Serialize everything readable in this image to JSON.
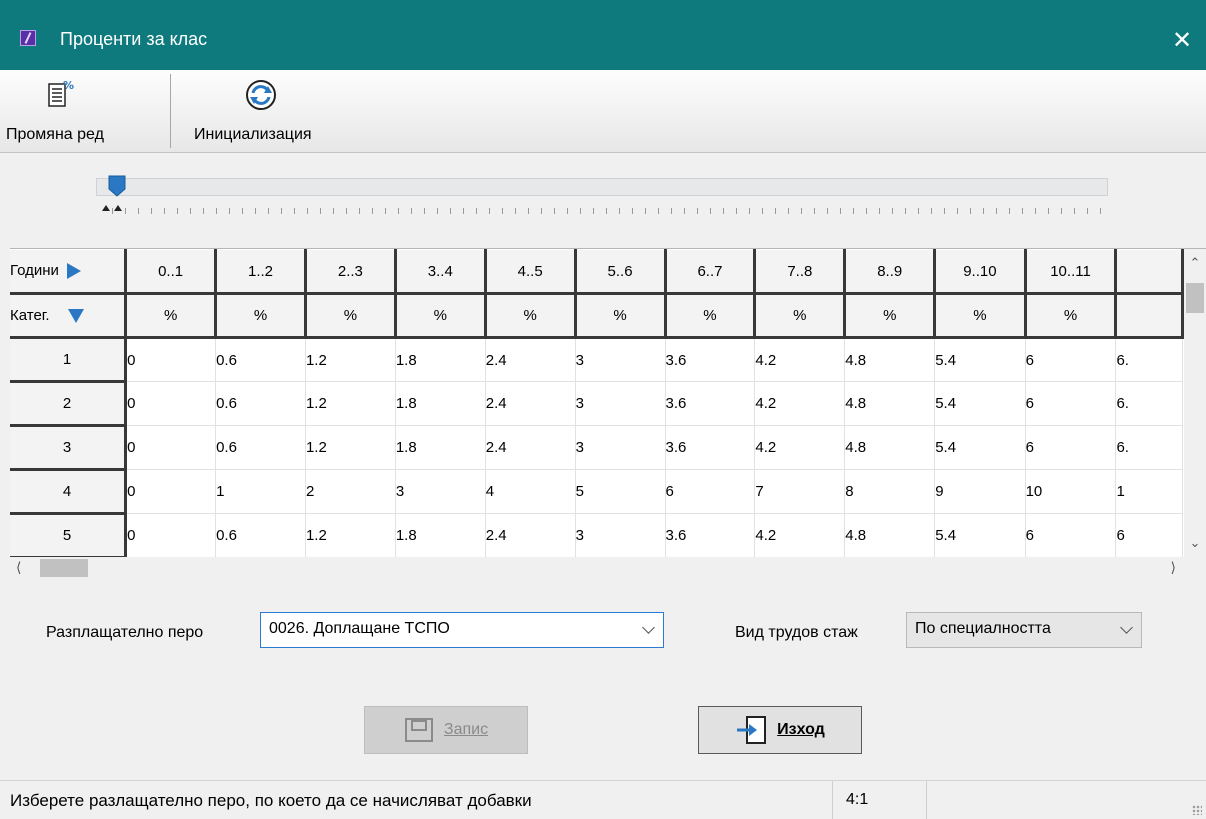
{
  "window": {
    "title": "Проценти за клас",
    "close_glyph": "✕"
  },
  "toolbar": {
    "change_row_label": "Промяна ред",
    "change_row_icon": "document-percent-icon",
    "init_label": "Инициализация",
    "init_icon": "refresh-icon"
  },
  "slider": {
    "value_fraction": 0.0
  },
  "grid": {
    "corner_years": "Години",
    "corner_categ": "Катег.",
    "columns": [
      "0..1",
      "1..2",
      "2..3",
      "3..4",
      "4..5",
      "5..6",
      "6..7",
      "7..8",
      "8..9",
      "9..10",
      "10..11",
      ""
    ],
    "units": [
      "%",
      "%",
      "%",
      "%",
      "%",
      "%",
      "%",
      "%",
      "%",
      "%",
      "%",
      ""
    ],
    "rows": [
      {
        "label": "1",
        "values": [
          "0",
          "0.6",
          "1.2",
          "1.8",
          "2.4",
          "3",
          "3.6",
          "4.2",
          "4.8",
          "5.4",
          "6",
          "6."
        ]
      },
      {
        "label": "2",
        "values": [
          "0",
          "0.6",
          "1.2",
          "1.8",
          "2.4",
          "3",
          "3.6",
          "4.2",
          "4.8",
          "5.4",
          "6",
          "6."
        ]
      },
      {
        "label": "3",
        "values": [
          "0",
          "0.6",
          "1.2",
          "1.8",
          "2.4",
          "3",
          "3.6",
          "4.2",
          "4.8",
          "5.4",
          "6",
          "6."
        ]
      },
      {
        "label": "4",
        "values": [
          "0",
          "1",
          "2",
          "3",
          "4",
          "5",
          "6",
          "7",
          "8",
          "9",
          "10",
          "1"
        ]
      },
      {
        "label": "5",
        "values": [
          "0",
          "0.6",
          "1.2",
          "1.8",
          "2.4",
          "3",
          "3.6",
          "4.2",
          "4.8",
          "5.4",
          "6",
          "6"
        ]
      }
    ]
  },
  "form": {
    "pay_item_label": "Разплащателно перо",
    "pay_item_value": "0026. Доплащане ТСПО",
    "service_type_label": "Вид трудов стаж",
    "service_type_value": "По специалността"
  },
  "buttons": {
    "save_label": "Запис",
    "exit_label": "Изход"
  },
  "status": {
    "message": "Изберете разлащателно перо, по което да се начисляват добавки",
    "position": "4:1"
  },
  "colors": {
    "titlebar": "#0f7a7e",
    "accent": "#2a78c3"
  }
}
